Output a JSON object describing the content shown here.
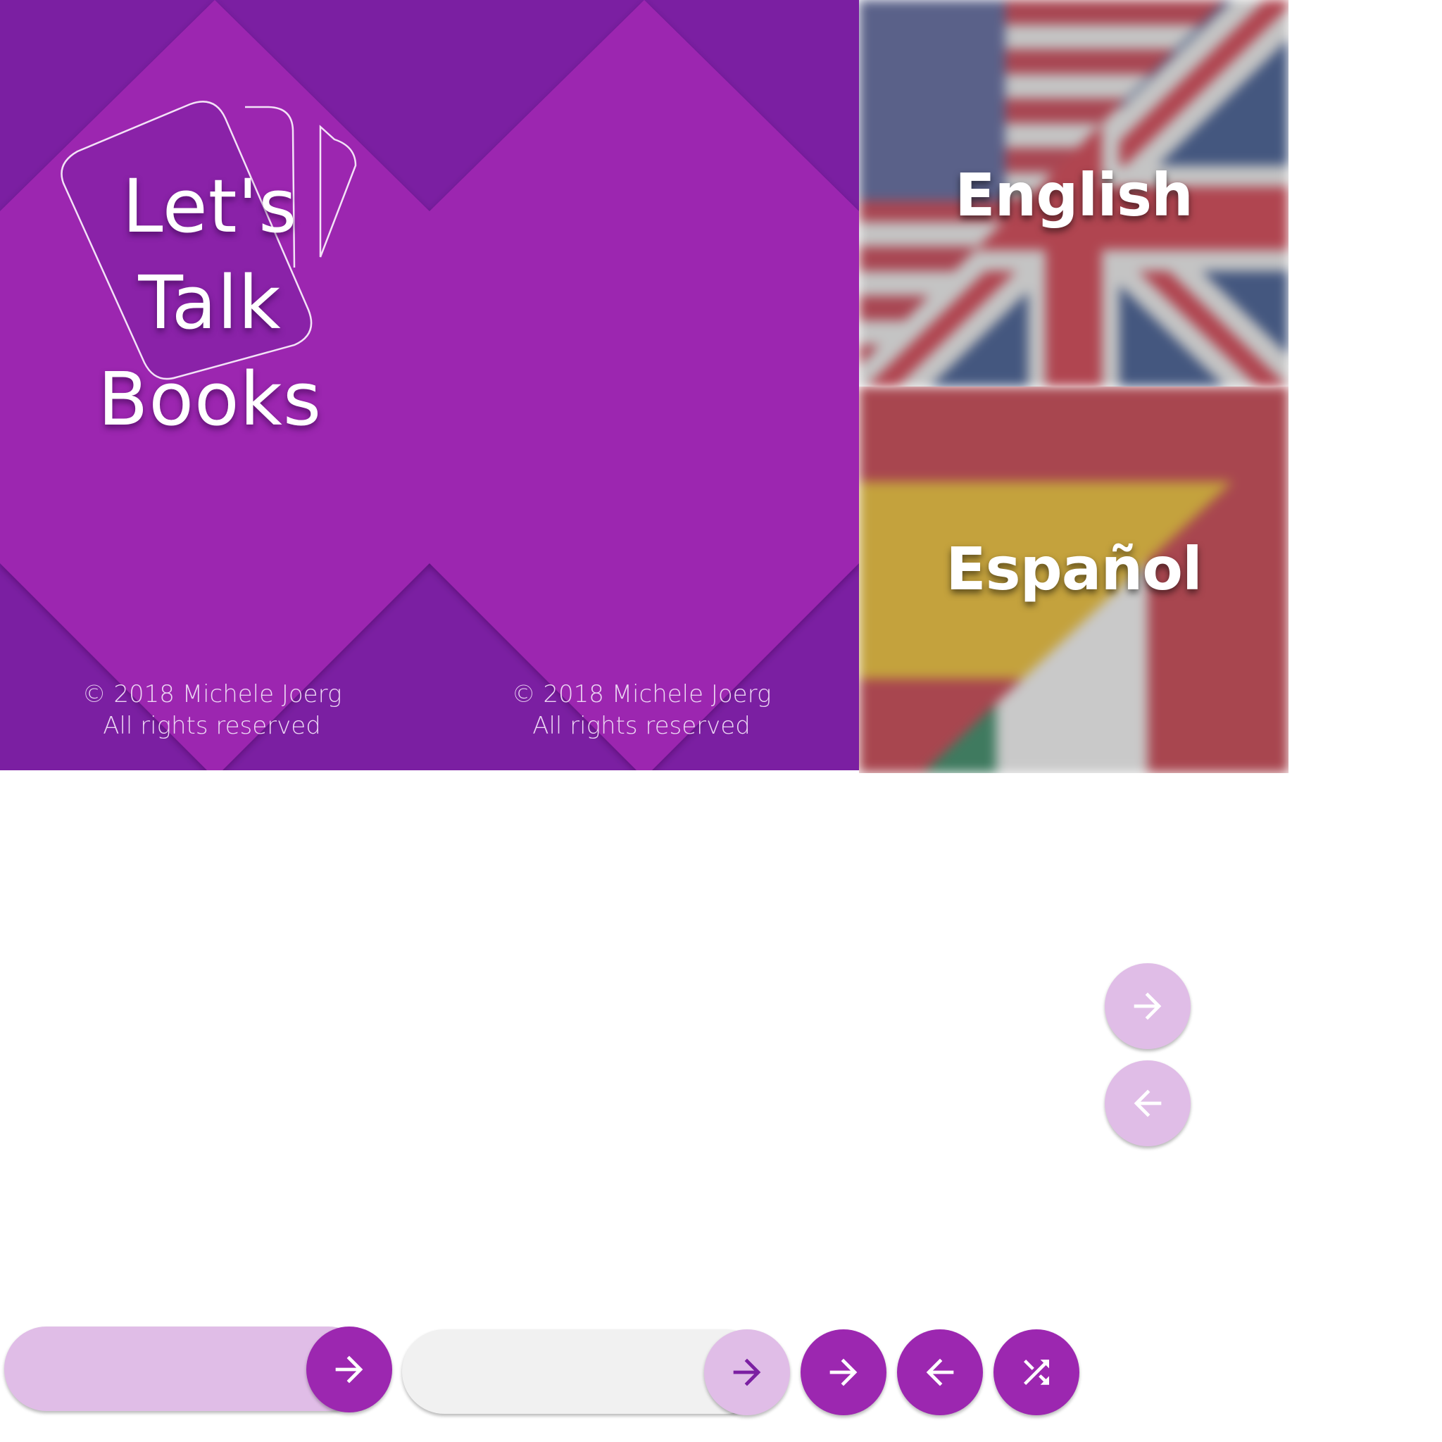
{
  "splash": {
    "title_line1": "Let's Talk",
    "title_line2": "Books",
    "copyright_line1": "© 2018 Michele Joerg",
    "copyright_line2": "All rights reserved",
    "background_color": "#9c27b0",
    "pattern_color": "#7b1fa2"
  },
  "languages": [
    {
      "label": "English",
      "flag": "usa-uk-flag-icon"
    },
    {
      "label": "Español",
      "flag": "spain-mexico-flag-icon"
    }
  ],
  "buttons": {
    "forward_icon": "arrow-right-icon",
    "back_icon": "arrow-left-icon",
    "shuffle_icon": "shuffle-icon",
    "primary_color": "#9c27b0",
    "light_color": "#e0bde7",
    "neutral_color": "#f1f1f1"
  }
}
